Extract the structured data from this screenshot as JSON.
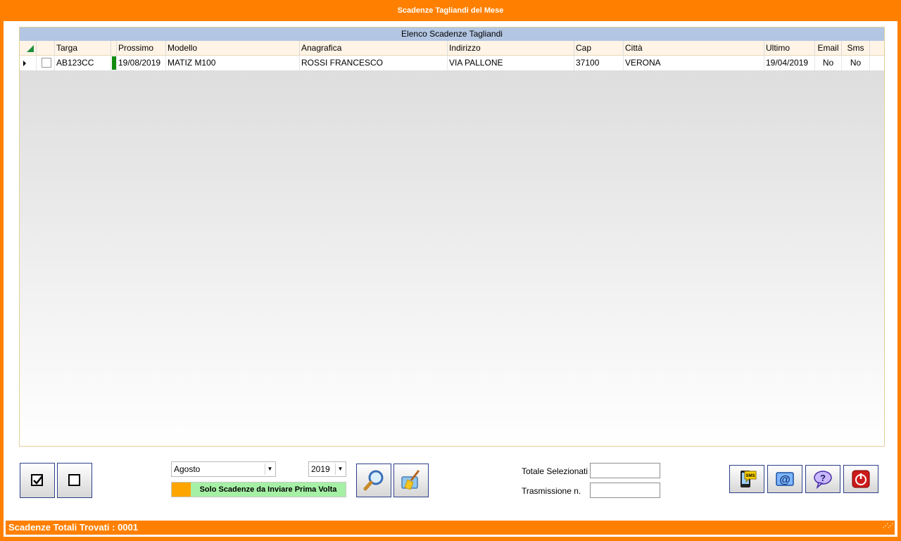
{
  "window": {
    "title": "Scadenze Tagliandi del Mese"
  },
  "grid": {
    "caption": "Elenco Scadenze Tagliandi",
    "columns": [
      "Targa",
      "Prossimo",
      "Modello",
      "Anagrafica",
      "Indirizzo",
      "Cap",
      "Città",
      "Ultimo",
      "Email",
      "Sms"
    ],
    "rows": [
      {
        "targa": "AB123CC",
        "prossimo": "19/08/2019",
        "modello": "MATIZ M100",
        "anagrafica": "ROSSI FRANCESCO",
        "indirizzo": "VIA PALLONE",
        "cap": "37100",
        "citta": "VERONA",
        "ultimo": "19/04/2019",
        "email": "No",
        "sms": "No",
        "checked": false
      }
    ]
  },
  "filters": {
    "month": "Agosto",
    "year": "2019",
    "toggle_label": "Solo Scadenze da Inviare Prima Volta"
  },
  "summary": {
    "totale_label": "Totale Selezionati",
    "trasmissione_label": "Trasmissione n.",
    "totale_value": "",
    "trasmissione_value": ""
  },
  "icons": {
    "select_all": "checkmark-box-icon",
    "deselect_all": "empty-box-icon",
    "search": "magnifier-icon",
    "clear": "broom-icon",
    "sms": "sms-phone-icon",
    "email": "at-mail-icon",
    "help": "question-bubble-icon",
    "exit": "power-icon"
  },
  "colors": {
    "frame": "#ff8000",
    "caption_bg": "#b3c6e2",
    "status_green": "#118c11",
    "toggle_bg": "#a6f0a6"
  },
  "status": {
    "text": "Scadenze Totali Trovati : 0001"
  }
}
